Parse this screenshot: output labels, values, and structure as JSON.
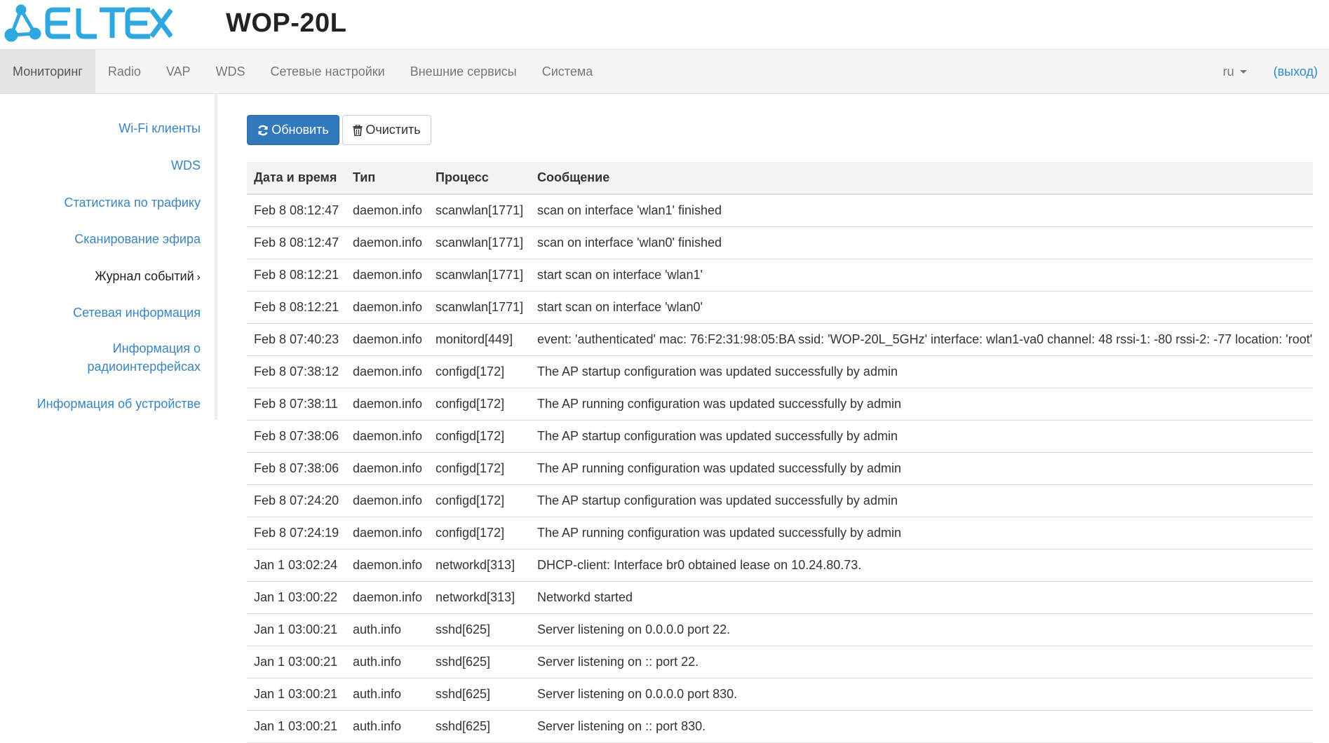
{
  "header": {
    "logo_text": "ELTEX",
    "device_title": "WOP-20L"
  },
  "nav": {
    "items": [
      {
        "label": "Мониторинг",
        "active": true
      },
      {
        "label": "Radio",
        "active": false
      },
      {
        "label": "VAP",
        "active": false
      },
      {
        "label": "WDS",
        "active": false
      },
      {
        "label": "Сетевые настройки",
        "active": false
      },
      {
        "label": "Внешние сервисы",
        "active": false
      },
      {
        "label": "Система",
        "active": false
      }
    ],
    "language": "ru",
    "logout": "(выход)"
  },
  "sidebar": {
    "items": [
      {
        "label": "Wi-Fi клиенты"
      },
      {
        "label": "WDS"
      },
      {
        "label": "Статистика по трафику"
      },
      {
        "label": "Сканирование эфира"
      },
      {
        "label": "Журнал событий"
      },
      {
        "label": "Сетевая информация"
      },
      {
        "label_line1": "Информация о",
        "label_line2": "радиоинтерфейсах"
      },
      {
        "label": "Информация об устройстве"
      }
    ],
    "active_index": 4
  },
  "toolbar": {
    "refresh_label": "Обновить",
    "clear_label": "Очистить"
  },
  "colors": {
    "logo": "#2fa8e0",
    "link": "#3a84c1",
    "primary_button": "#3279bb",
    "nav_background": "#f5f5f5"
  },
  "table": {
    "headers": [
      "Дата и время",
      "Тип",
      "Процесс",
      "Сообщение"
    ],
    "rows": [
      [
        "Feb 8 08:12:47",
        "daemon.info",
        "scanwlan[1771]",
        "scan on interface 'wlan1' finished"
      ],
      [
        "Feb 8 08:12:47",
        "daemon.info",
        "scanwlan[1771]",
        "scan on interface 'wlan0' finished"
      ],
      [
        "Feb 8 08:12:21",
        "daemon.info",
        "scanwlan[1771]",
        "start scan on interface 'wlan1'"
      ],
      [
        "Feb 8 08:12:21",
        "daemon.info",
        "scanwlan[1771]",
        "start scan on interface 'wlan0'"
      ],
      [
        "Feb 8 07:40:23",
        "daemon.info",
        "monitord[449]",
        "event: 'authenticated' mac: 76:F2:31:98:05:BA ssid: 'WOP-20L_5GHz' interface: wlan1-va0 channel: 48 rssi-1: -80 rssi-2: -77 location: 'root'"
      ],
      [
        "Feb 8 07:38:12",
        "daemon.info",
        "configd[172]",
        "The AP startup configuration was updated successfully by admin"
      ],
      [
        "Feb 8 07:38:11",
        "daemon.info",
        "configd[172]",
        "The AP running configuration was updated successfully by admin"
      ],
      [
        "Feb 8 07:38:06",
        "daemon.info",
        "configd[172]",
        "The AP startup configuration was updated successfully by admin"
      ],
      [
        "Feb 8 07:38:06",
        "daemon.info",
        "configd[172]",
        "The AP running configuration was updated successfully by admin"
      ],
      [
        "Feb 8 07:24:20",
        "daemon.info",
        "configd[172]",
        "The AP startup configuration was updated successfully by admin"
      ],
      [
        "Feb 8 07:24:19",
        "daemon.info",
        "configd[172]",
        "The AP running configuration was updated successfully by admin"
      ],
      [
        "Jan 1 03:02:24",
        "daemon.info",
        "networkd[313]",
        "DHCP-client: Interface br0 obtained lease on 10.24.80.73."
      ],
      [
        "Jan 1 03:00:22",
        "daemon.info",
        "networkd[313]",
        "Networkd started"
      ],
      [
        "Jan 1 03:00:21",
        "auth.info",
        "sshd[625]",
        "Server listening on 0.0.0.0 port 22."
      ],
      [
        "Jan 1 03:00:21",
        "auth.info",
        "sshd[625]",
        "Server listening on :: port 22."
      ],
      [
        "Jan 1 03:00:21",
        "auth.info",
        "sshd[625]",
        "Server listening on 0.0.0.0 port 830."
      ],
      [
        "Jan 1 03:00:21",
        "auth.info",
        "sshd[625]",
        "Server listening on :: port 830."
      ]
    ]
  }
}
